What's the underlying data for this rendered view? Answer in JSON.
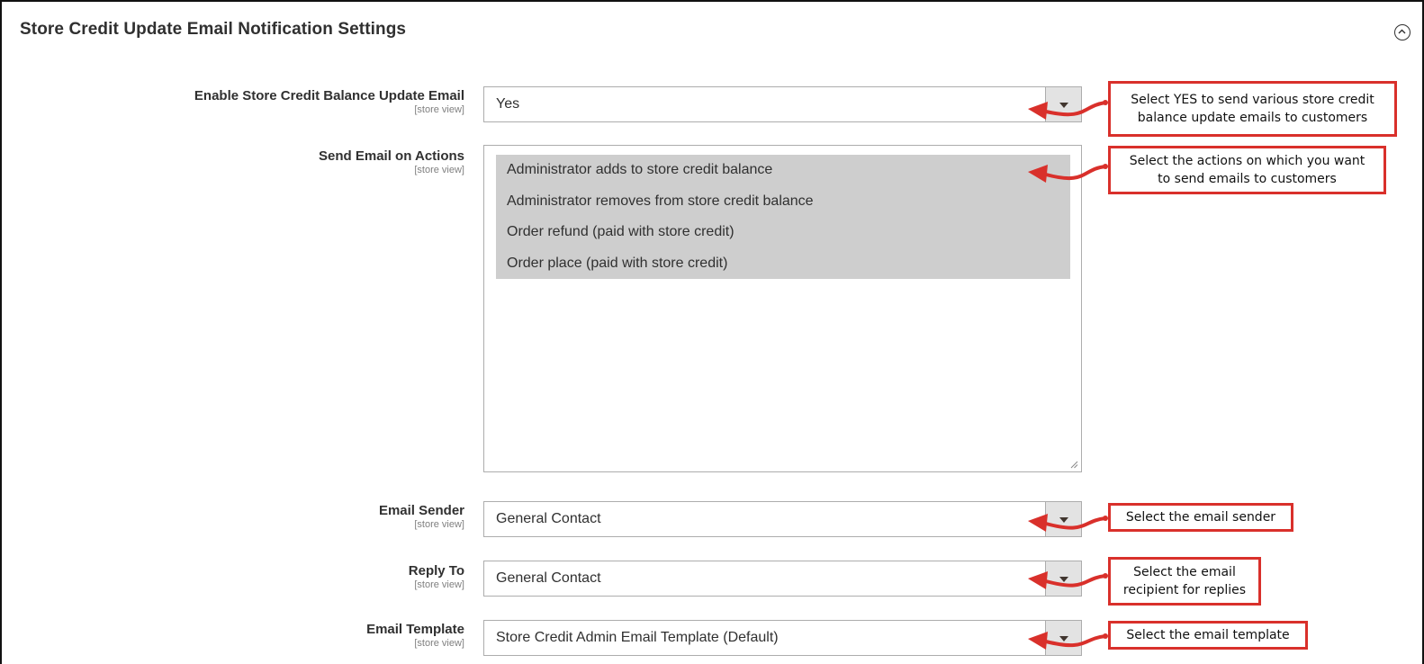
{
  "section": {
    "title": "Store Credit Update Email Notification Settings"
  },
  "fields": {
    "enable": {
      "label": "Enable Store Credit Balance Update Email",
      "scope": "[store view]",
      "value": "Yes"
    },
    "actions": {
      "label": "Send Email on Actions",
      "scope": "[store view]",
      "options": [
        "Administrator adds to store credit balance",
        "Administrator removes from store credit balance",
        "Order refund (paid with store credit)",
        "Order place (paid with store credit)"
      ]
    },
    "sender": {
      "label": "Email Sender",
      "scope": "[store view]",
      "value": "General Contact"
    },
    "reply_to": {
      "label": "Reply To",
      "scope": "[store view]",
      "value": "General Contact"
    },
    "template": {
      "label": "Email Template",
      "scope": "[store view]",
      "value": "Store Credit Admin Email Template (Default)"
    }
  },
  "callouts": {
    "enable": [
      "Select YES to send various store credit",
      "balance update emails to customers"
    ],
    "actions": [
      "Select the actions on which you want",
      "to send emails to customers"
    ],
    "sender": [
      "Select the email sender"
    ],
    "reply_to": [
      "Select the email",
      "recipient for replies"
    ],
    "template": [
      "Select the email template"
    ]
  },
  "colors": {
    "callout_border": "#d9302b",
    "selected_option_bg": "#cecece",
    "select_button_bg": "#e3e3e3"
  },
  "icons": {
    "collapse": "collapse-circle-icon",
    "dropdown": "caret-down-icon"
  }
}
